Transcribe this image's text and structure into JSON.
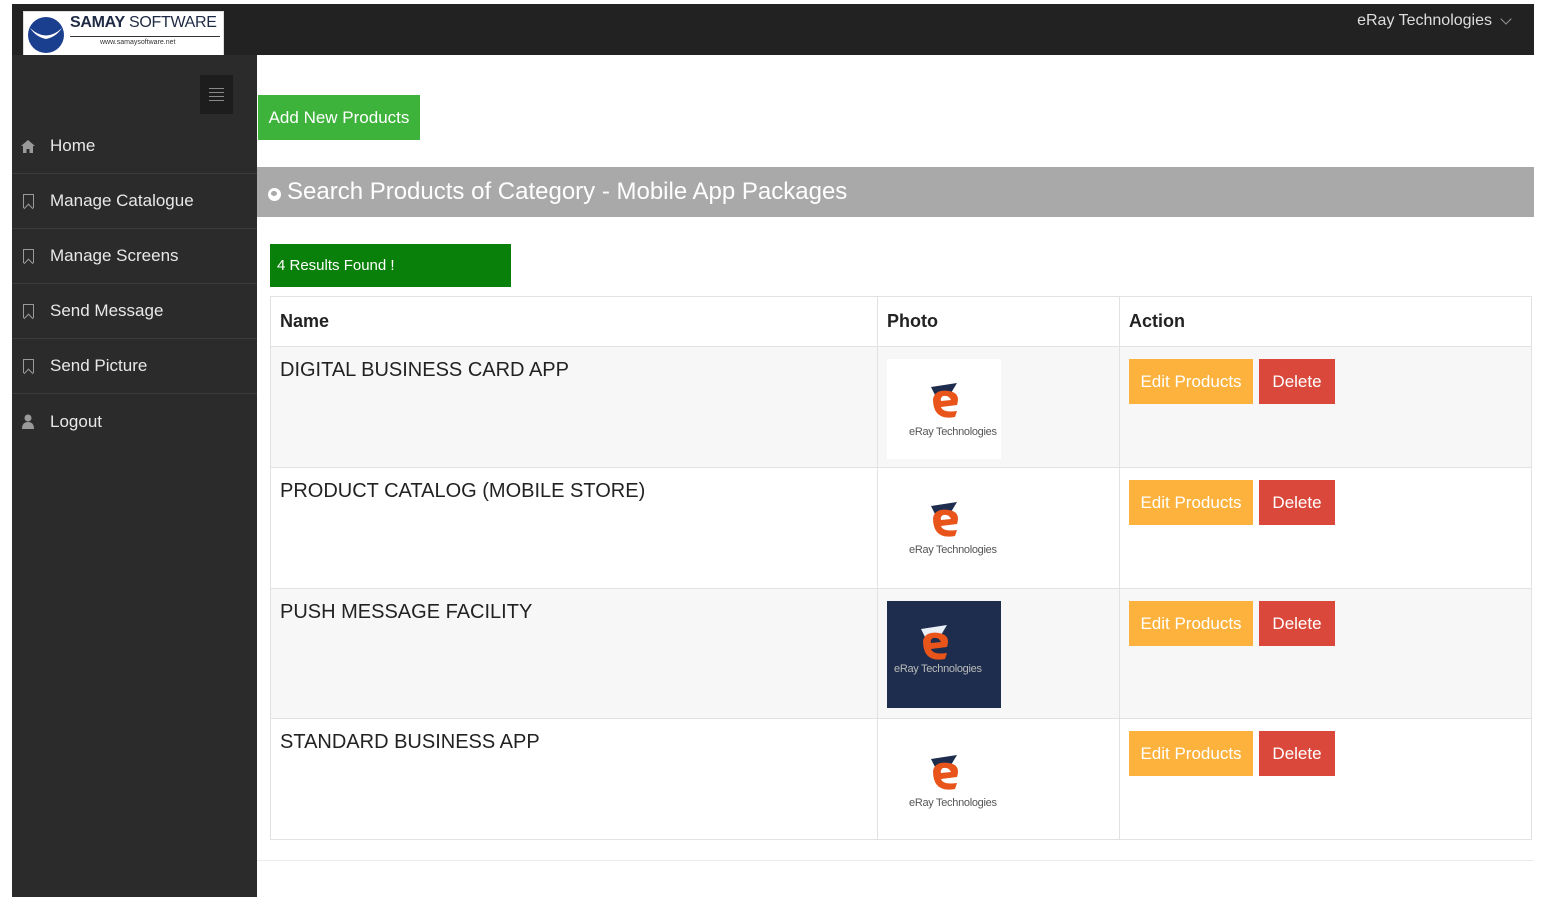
{
  "header": {
    "brand_bold": "SAMAY",
    "brand_light": "SOFTWARE",
    "brand_url": "www.samaysoftware.net",
    "user_name": "eRay Technologies",
    "bar_color": "#222222"
  },
  "sidebar": {
    "toggle_icon": "hamburger-icon",
    "items": [
      {
        "label": "Home",
        "icon": "home-icon"
      },
      {
        "label": "Manage Catalogue",
        "icon": "bookmark-icon"
      },
      {
        "label": "Manage Screens",
        "icon": "bookmark-icon"
      },
      {
        "label": "Send Message",
        "icon": "bookmark-icon"
      },
      {
        "label": "Send Picture",
        "icon": "bookmark-icon"
      },
      {
        "label": "Logout",
        "icon": "user-icon"
      }
    ]
  },
  "main": {
    "add_button": "Add New Products",
    "section_title": "Search Products of Category - Mobile App Packages",
    "results_text": "4 Results Found !",
    "columns": [
      "Name",
      "Photo",
      "Action"
    ],
    "rows": [
      {
        "name": "DIGITAL BUSINESS CARD APP",
        "photo_caption": "eRay Technologies",
        "photo_theme": "light"
      },
      {
        "name": "PRODUCT CATALOG (MOBILE STORE)",
        "photo_caption": "eRay Technologies",
        "photo_theme": "light"
      },
      {
        "name": "PUSH MESSAGE FACILITY",
        "photo_caption": "eRay Technologies",
        "photo_theme": "dark"
      },
      {
        "name": "STANDARD BUSINESS APP",
        "photo_caption": "eRay Technologies",
        "photo_theme": "light"
      }
    ],
    "edit_label": "Edit Products",
    "delete_label": "Delete",
    "colors": {
      "add": "#3db33b",
      "results": "#098009",
      "edit": "#fcb23c",
      "delete": "#d9483b",
      "section": "#a9a9a9"
    }
  }
}
